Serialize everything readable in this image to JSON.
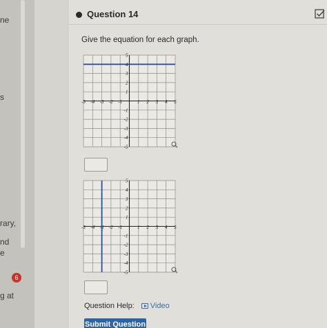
{
  "sidebar": {
    "fragments": [
      "ne",
      "s",
      "rary,",
      "nd",
      "e",
      "g at"
    ],
    "badge": "6"
  },
  "question": {
    "title": "Question 14",
    "prompt": "Give the equation for each graph."
  },
  "graphs": [
    {
      "x_ticks": [
        "-5",
        "-4",
        "-3",
        "-2",
        "-1",
        "1",
        "2",
        "3",
        "4",
        "5"
      ],
      "y_ticks": [
        "5",
        "4",
        "3",
        "2",
        "1",
        "-1",
        "-2",
        "-3",
        "-4",
        "-5"
      ],
      "line": {
        "orientation": "horizontal",
        "value": 4
      },
      "line_color": "#2b4fa0"
    },
    {
      "x_ticks": [
        "-5",
        "-4",
        "-3",
        "-2",
        "-1",
        "1",
        "2",
        "3",
        "4",
        "5"
      ],
      "y_ticks": [
        "5",
        "4",
        "3",
        "2",
        "1",
        "-1",
        "-2",
        "-3",
        "-4",
        "-5"
      ],
      "line": {
        "orientation": "vertical",
        "value": -3
      },
      "line_color": "#2b4fa0"
    }
  ],
  "help": {
    "label": "Question Help:",
    "video_label": "Video"
  },
  "submit_label": "Submit Question",
  "accent_color": "#2d64a8"
}
